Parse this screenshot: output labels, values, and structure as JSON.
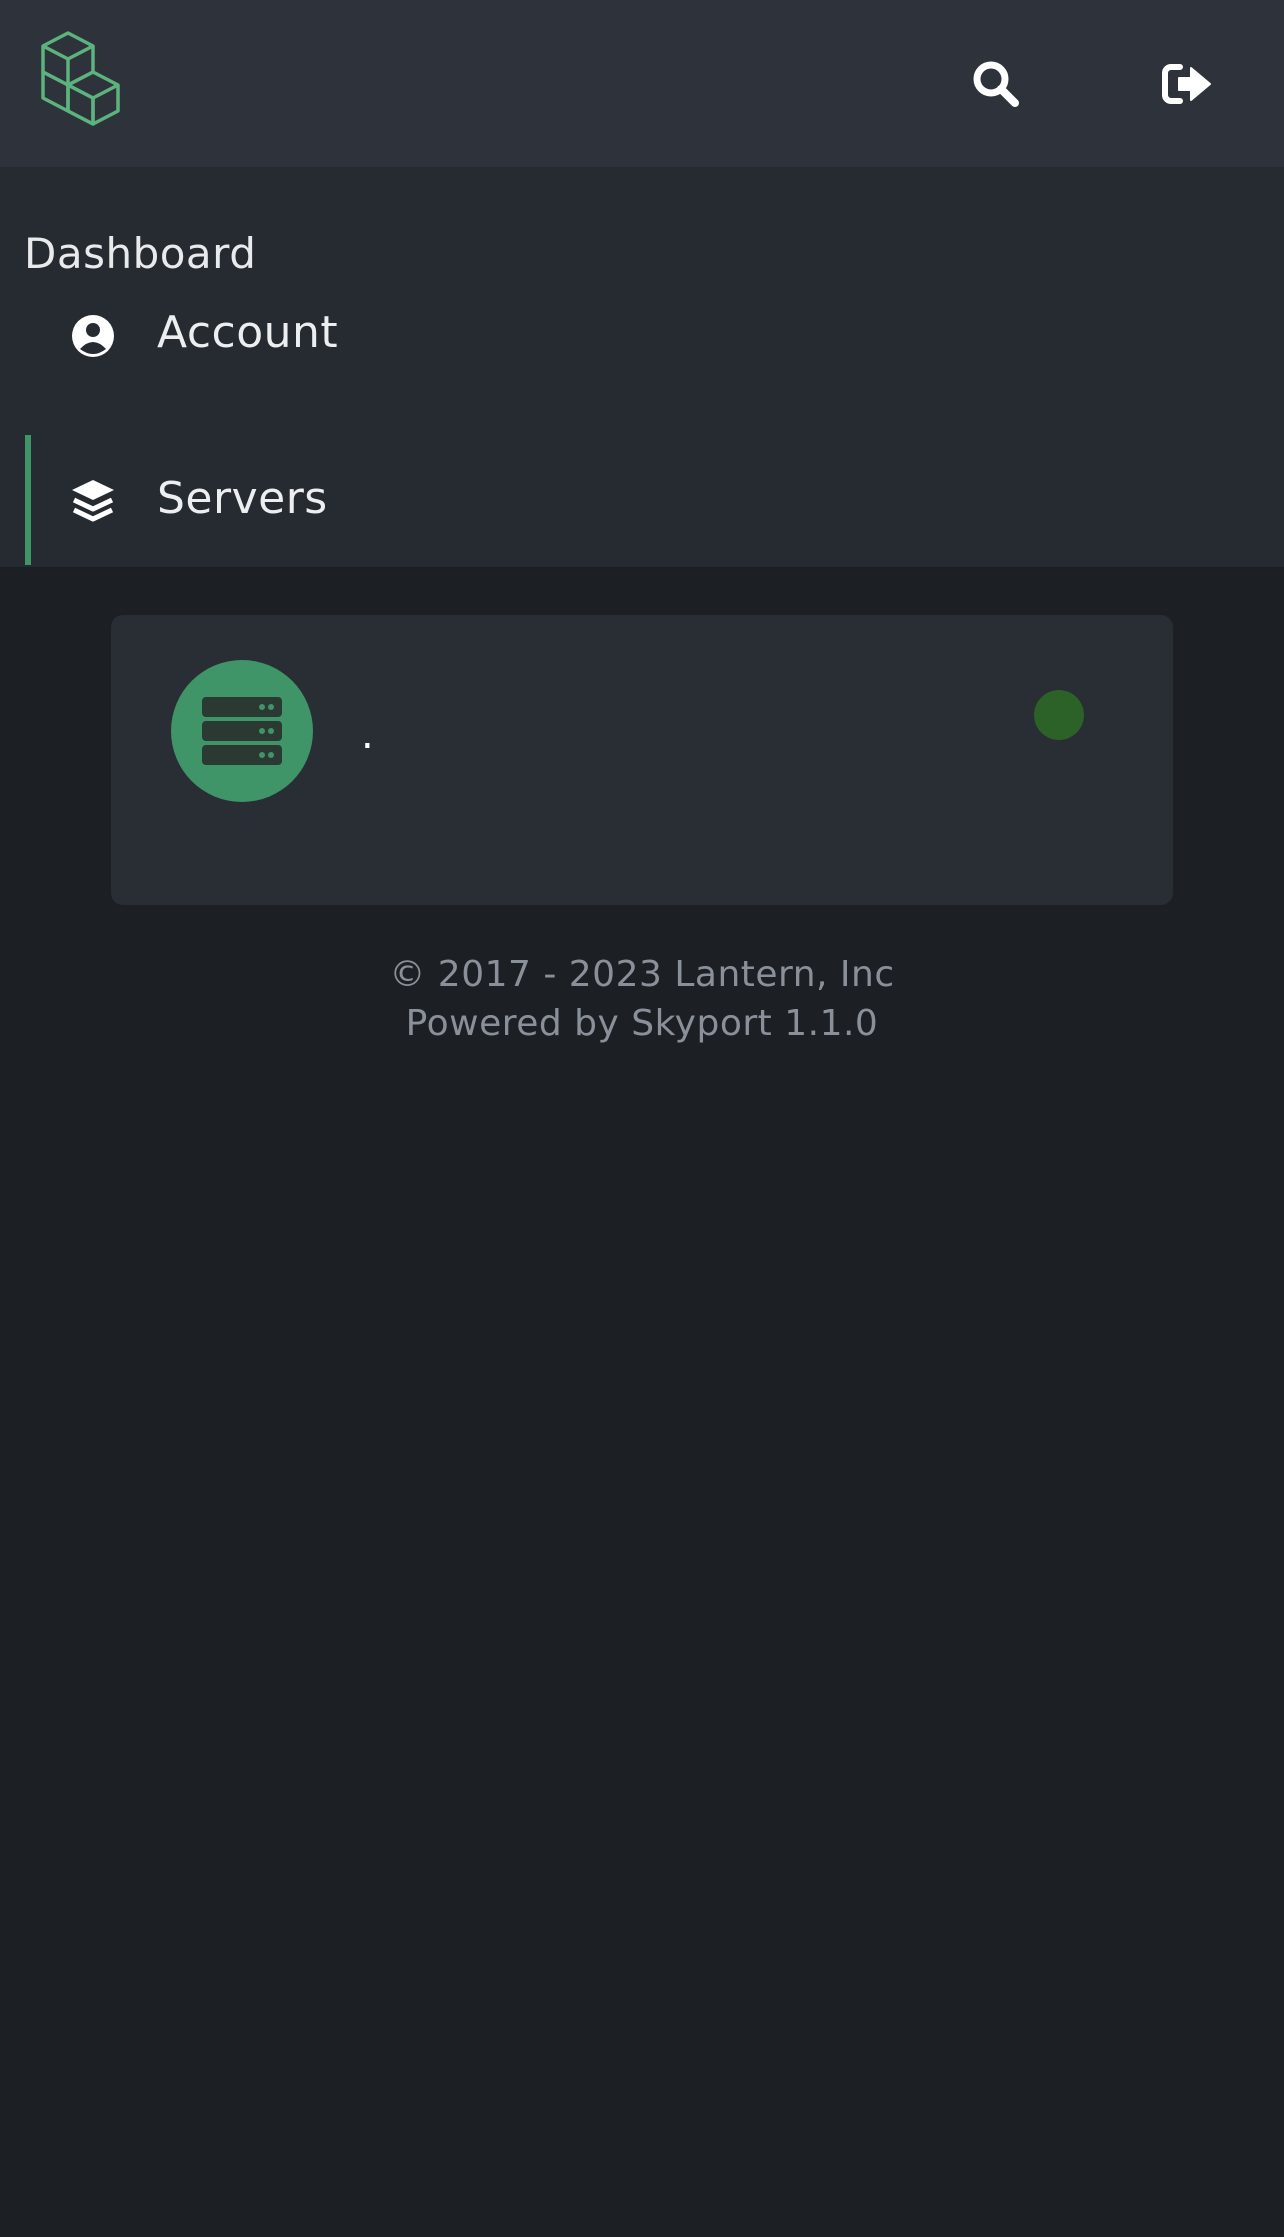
{
  "colors": {
    "page_bg": "#1c1f23",
    "topbar_bg": "#2e333b",
    "nav_bg": "#262a31",
    "card_bg": "#292d34",
    "accent": "#3f9468",
    "status_online": "#2c6128",
    "footer_text": "#8a9099"
  },
  "header": {
    "logo_icon": "cubes-logo-icon",
    "search_icon": "search-icon",
    "logout_icon": "sign-out-icon"
  },
  "nav": {
    "heading": "Dashboard",
    "items": [
      {
        "label": "Account",
        "icon": "user-circle-icon",
        "active": false
      },
      {
        "label": "Servers",
        "icon": "layers-icon",
        "active": true
      }
    ]
  },
  "servers": [
    {
      "name": ".",
      "icon": "server-icon",
      "status": "online"
    }
  ],
  "footer": {
    "copyright": "© 2017 - 2023 Lantern, Inc",
    "powered_by": "Powered by Skyport 1.1.0"
  }
}
